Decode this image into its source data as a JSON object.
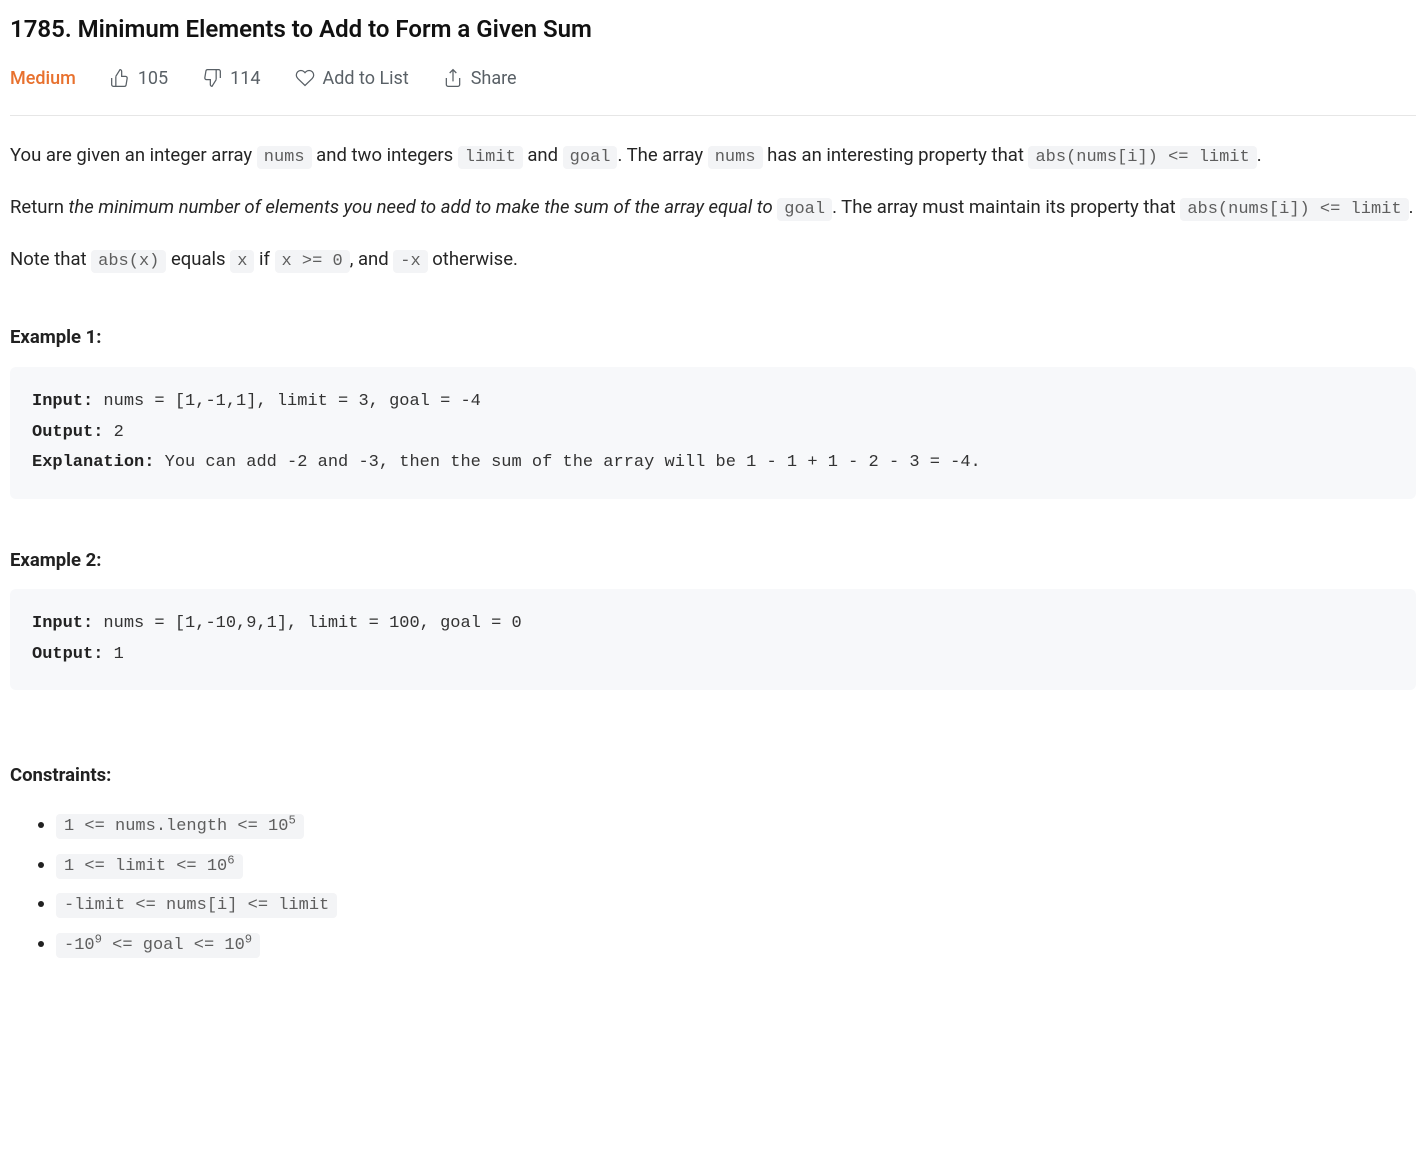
{
  "title": "1785. Minimum Elements to Add to Form a Given Sum",
  "meta": {
    "difficulty": "Medium",
    "likes": "105",
    "dislikes": "114",
    "add_to_list": "Add to List",
    "share": "Share"
  },
  "p1": {
    "t1": "You are given an integer array ",
    "c1": "nums",
    "t2": " and two integers ",
    "c2": "limit",
    "t3": " and ",
    "c3": "goal",
    "t4": ". The array ",
    "c4": "nums",
    "t5": " has an interesting property that ",
    "c5": "abs(nums[i]) <= limit",
    "t6": "."
  },
  "p2": {
    "t1": "Return ",
    "em": "the minimum number of elements you need to add to make the sum of the array equal to ",
    "c1": "goal",
    "t2": ". The array must maintain its property that ",
    "c2": "abs(nums[i]) <= limit",
    "t3": "."
  },
  "p3": {
    "t1": "Note that ",
    "c1": "abs(x)",
    "t2": " equals ",
    "c2": "x",
    "t3": " if ",
    "c3": "x >= 0",
    "t4": ", and ",
    "c4": "-x",
    "t5": " otherwise."
  },
  "examples": {
    "h1": "Example 1:",
    "h2": "Example 2:",
    "labels": {
      "input": "Input: ",
      "output": "Output: ",
      "explanation": "Explanation: "
    },
    "e1": {
      "input": "nums = [1,-1,1], limit = 3, goal = -4",
      "output": "2",
      "explanation": "You can add -2 and -3, then the sum of the array will be 1 - 1 + 1 - 2 - 3 = -4."
    },
    "e2": {
      "input": "nums = [1,-10,9,1], limit = 100, goal = 0",
      "output": "1"
    }
  },
  "constraints": {
    "heading": "Constraints:",
    "c1a": "1 <= nums.length <= 10",
    "c1b": "5",
    "c2a": "1 <= limit <= 10",
    "c2b": "6",
    "c3": "-limit <= nums[i] <= limit",
    "c4a": "-10",
    "c4b": "9",
    "c4c": " <= goal <= 10",
    "c4d": "9"
  }
}
